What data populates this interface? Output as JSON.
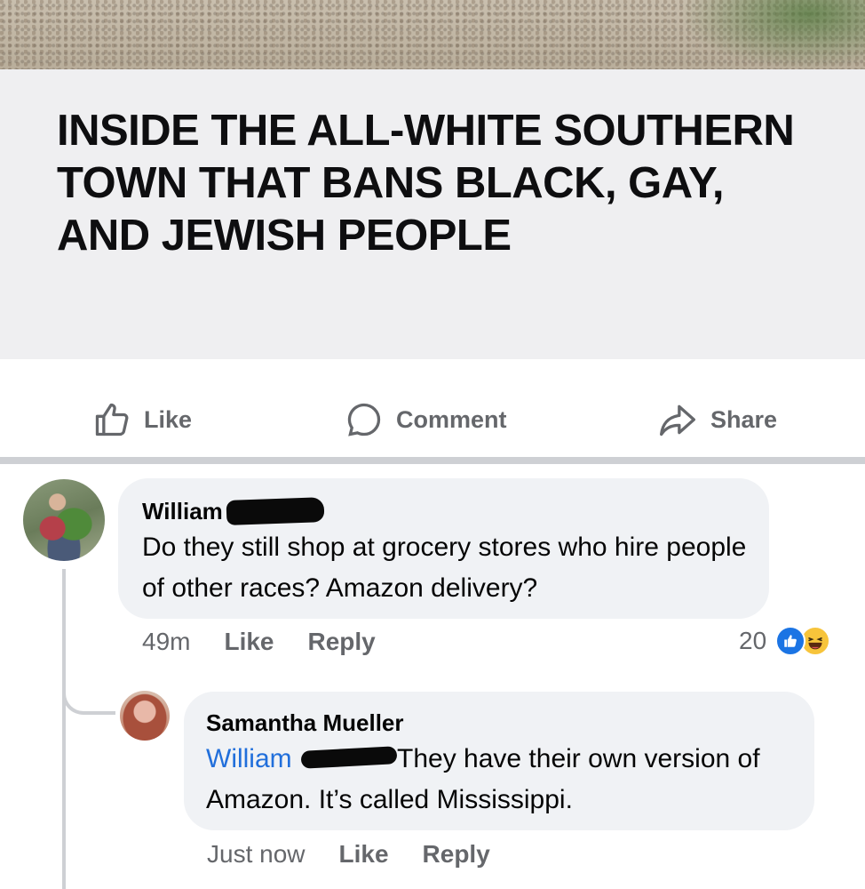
{
  "post": {
    "headline": "INSIDE THE ALL-WHITE SOUTHERN TOWN THAT BANS BLACK, GAY, AND JEWISH PEOPLE"
  },
  "actions": {
    "like_label": "Like",
    "comment_label": "Comment",
    "share_label": "Share"
  },
  "comments": [
    {
      "author_first": "William",
      "text": "Do they still shop at grocery stores who hire people of other races? Amazon delivery?",
      "time": "49m",
      "like_label": "Like",
      "reply_label": "Reply",
      "reaction_count": "20",
      "reactions": [
        "like-icon",
        "haha-icon"
      ]
    }
  ],
  "reply": {
    "author": "Samantha Mueller",
    "mention_first": "William",
    "text": "They have their own version of Amazon. It’s called Mississippi.",
    "time": "Just now",
    "like_label": "Like",
    "reply_label": "Reply"
  },
  "colors": {
    "mention": "#216fdb",
    "like_reaction": "#1b74e4",
    "haha_reaction": "#f7c43b",
    "bubble_bg": "#f0f2f5"
  }
}
